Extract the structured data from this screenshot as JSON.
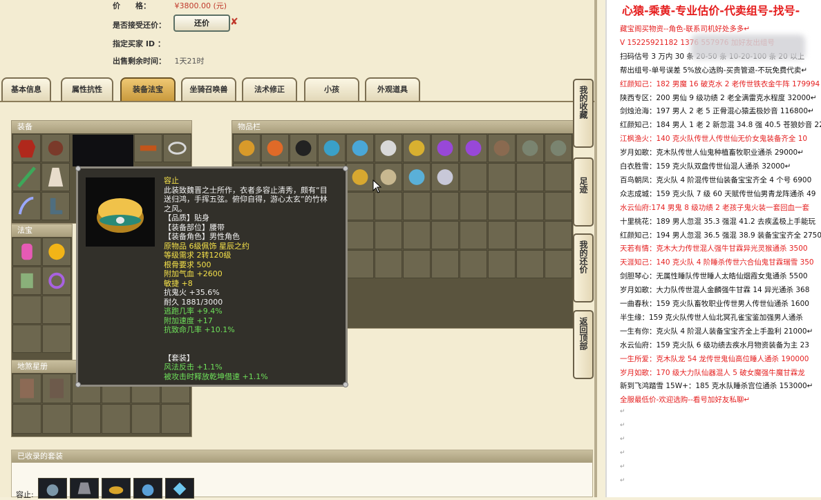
{
  "listing": {
    "price_label": "价　　格：",
    "price_value": "¥3800.00 (元)",
    "counter_label": "是否接受还价：",
    "counter_button": "还价",
    "buyer_label": "指定买家 ID ：",
    "time_label": "出售剩余时间：",
    "time_value": "1天21时"
  },
  "tabs": [
    {
      "label": "基本信息",
      "active": false
    },
    {
      "label": "属性抗性",
      "active": false
    },
    {
      "label": "装备法宝",
      "active": true
    },
    {
      "label": "坐骑召唤兽",
      "active": false
    },
    {
      "label": "法术修正",
      "active": false
    },
    {
      "label": "小孩",
      "active": false
    },
    {
      "label": "外观道具",
      "active": false
    }
  ],
  "panels": {
    "equip": "装备",
    "fabao": "法宝",
    "dishu": "地煞星册",
    "inventory": "物品栏",
    "sets_collected": "已收录的套装",
    "sets_label": "容止:"
  },
  "tooltip": {
    "name": "容止",
    "description": [
      "此装致魏晋之士所作，衣者多容止清秀，颇有“目",
      "送归鸿，手挥五弦。俯仰自得，游心太玄”的竹林",
      "之风。"
    ],
    "lines": [
      {
        "text": "【品质】贴身",
        "color": "white"
      },
      {
        "text": "【装备部位】腰带",
        "color": "white"
      },
      {
        "text": "【装备角色】男性角色",
        "color": "white"
      },
      {
        "text": "原物品 6级佩饰 星辰之约",
        "color": "yellow"
      },
      {
        "text": "等级需求 2转120级",
        "color": "yellow"
      },
      {
        "text": "根骨要求 500",
        "color": "yellow"
      },
      {
        "text": "附加气血 +2600",
        "color": "yellow"
      },
      {
        "text": "敏捷 +8",
        "color": "yellow"
      },
      {
        "text": "抗鬼火 +35.6%",
        "color": "white"
      },
      {
        "text": "耐久 1881/3000",
        "color": "white"
      },
      {
        "text": "逃跑几率 +9.4%",
        "color": "green"
      },
      {
        "text": "附加速度 +17",
        "color": "green"
      },
      {
        "text": "抗致命几率 +10.1%",
        "color": "green"
      }
    ],
    "set_title": "【套装】",
    "set_lines": [
      "风法反击 +1.1%",
      "被攻击时释放乾坤借速 +1.1%"
    ]
  },
  "sidebar": [
    {
      "label": "我的收藏"
    },
    {
      "label": "足迹"
    },
    {
      "label": "我的还价"
    },
    {
      "label": "返回顶部"
    }
  ],
  "doc": {
    "title": "心猿-乘黄-专业估价-代卖组号-找号-",
    "lines": [
      {
        "text": "藏宝阁买物资--角色-联系司机好处多多↵",
        "red": true
      },
      {
        "text": "V 15225921182 1376 557976 加好友出组号",
        "red": true
      },
      {
        "text": "扫码估号 3 万内 30 条 20-50 条 10-20-100 条 20 以上",
        "red": false
      },
      {
        "text": "帮出组号-单号误差 5%放心选购-买贵管退-不玩免费代卖↵",
        "red": false
      },
      {
        "text": "红颜知己：182 男魔 16 破克水 2 老传世铁衣金牛阵 179994",
        "red": true
      },
      {
        "text": "陕西专区：200 男仙 9 级功绩 2 老全满雷克水程度 32000↵",
        "red": false
      },
      {
        "text": "剑烛沧海：197 男人 2 老 5 正骨混心猿盂极妙音 116800↵",
        "red": false
      },
      {
        "text": "红颜知己：184 男人 1 老 2 新忽混 34.8 强 40.5 苍狼妙音 22",
        "red": false
      },
      {
        "text": "江枫渔火：140 克火队传世人传世仙无价女鬼装备齐全 10",
        "red": true
      },
      {
        "text": "岁月如歌：克木队传世人仙鬼种植畜牧职业通杀 29000↵",
        "red": false
      },
      {
        "text": "白衣胜雪：159 克火队双盘传世仙混人通杀 32000↵",
        "red": false
      },
      {
        "text": "百鸟朝凤：克火队 4 阶混传世仙装备宝宝齐全 4 个号 6900",
        "red": false
      },
      {
        "text": "众志成城：159 克火队 7 级 60 天赋传世仙男青龙阵通杀 49",
        "red": false
      },
      {
        "text": "水云仙府:174 男鬼 8 级功绩 2 老孩子鬼火装一套回血一套",
        "red": true
      },
      {
        "text": "十里桃花：189 男人忽混 35.3 强混 41.2 去疾孟极上手能玩",
        "red": false
      },
      {
        "text": "红颜知己：194 男人忽混 36.5 强混 38.9 装备宝宝齐全 2750",
        "red": false
      },
      {
        "text": "天若有情：克木大力传世混人强牛甘霖异光灵猴通杀 3500",
        "red": true
      },
      {
        "text": "天涯知己：140 克火队 4 阶睡杀传世六合仙鬼甘霖瑞雪 350",
        "red": true
      },
      {
        "text": "剑胆琴心：无属性睡队传世睡人太皓仙烟霞女鬼通杀 5500",
        "red": false
      },
      {
        "text": "岁月如歌：大力队传世混人金麟强牛甘霖 14 异光通杀 368",
        "red": false
      },
      {
        "text": "一曲春秋：159 克火队畜牧职业传世男人传世仙通杀 1600",
        "red": false
      },
      {
        "text": "半生缘：159 克火队传世人仙北冥孔雀宝鉴加强男人通杀",
        "red": false
      },
      {
        "text": "一生有你：克火队 4 阶混人装备宝宝齐全上手盈利 21000↵",
        "red": false
      },
      {
        "text": "水云仙府：159 克火队 6 级功绩去疾水月物资装备为主 23",
        "red": false
      },
      {
        "text": "一生所爱：克木队龙 54 龙传世鬼仙高位睡人通杀 190000",
        "red": true
      },
      {
        "text": "岁月如歌：170 级大力队仙器混人 5 破女魔强牛魔甘霖龙",
        "red": true
      },
      {
        "text": "新到飞鸿踏雪 15W+：185 克水队睡杀宫位通杀 153000↵",
        "red": false
      },
      {
        "text": "全服最低价-欢迎选购--看号加好友私聊↵",
        "red": true
      }
    ],
    "empty_mark": "↵"
  }
}
